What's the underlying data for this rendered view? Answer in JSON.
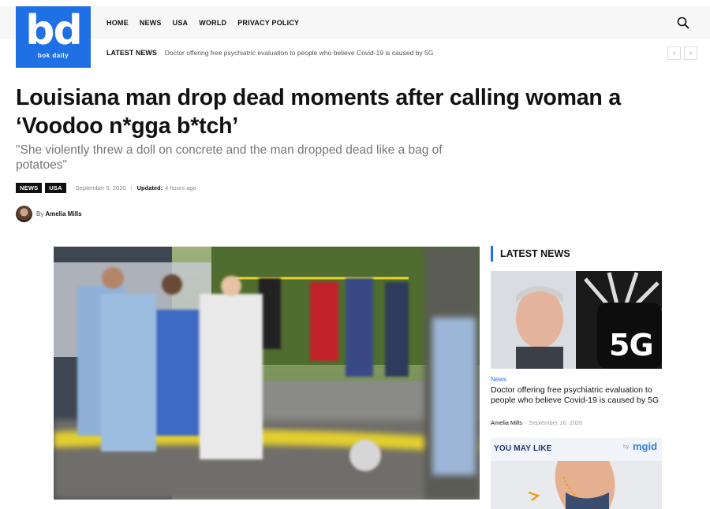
{
  "logo": {
    "big": "bd",
    "small": "bok daily"
  },
  "nav": {
    "items": [
      "HOME",
      "NEWS",
      "USA",
      "WORLD",
      "PRIVACY POLICY"
    ]
  },
  "ticker": {
    "label": "LATEST NEWS",
    "headline": "Doctor offering free psychiatric evaluation to people who believe Covid-19 is caused by 5G",
    "prev": "‹",
    "next": "›"
  },
  "article": {
    "title_line1": "Louisiana man drop dead moments after calling woman a",
    "title_line2": "‘Voodoo n*gga b*tch’",
    "subtitle": "\"She violently threw a doll on concrete and the man dropped dead like a bag of potatoes\"",
    "tags": [
      "NEWS",
      "USA"
    ],
    "date": "September 5, 2020",
    "separator": "|",
    "updated_label": "Updated:",
    "updated_value": "4 hours ago",
    "by": "By",
    "author": "Amelia Mills"
  },
  "sidebar": {
    "heading": "LATEST NEWS",
    "image_text": "5G",
    "category": "News",
    "title": "Doctor offering free psychiatric evaluation to people who believe Covid-19 is caused by 5G",
    "author": "Amelia Mills",
    "dash": "-",
    "date": "September 16, 2020"
  },
  "ymal": {
    "label": "YOU MAY LIKE",
    "by": "by",
    "brand": "mgid"
  },
  "colors": {
    "brand_blue": "#1f6fe5",
    "tag_bg": "#111111"
  }
}
